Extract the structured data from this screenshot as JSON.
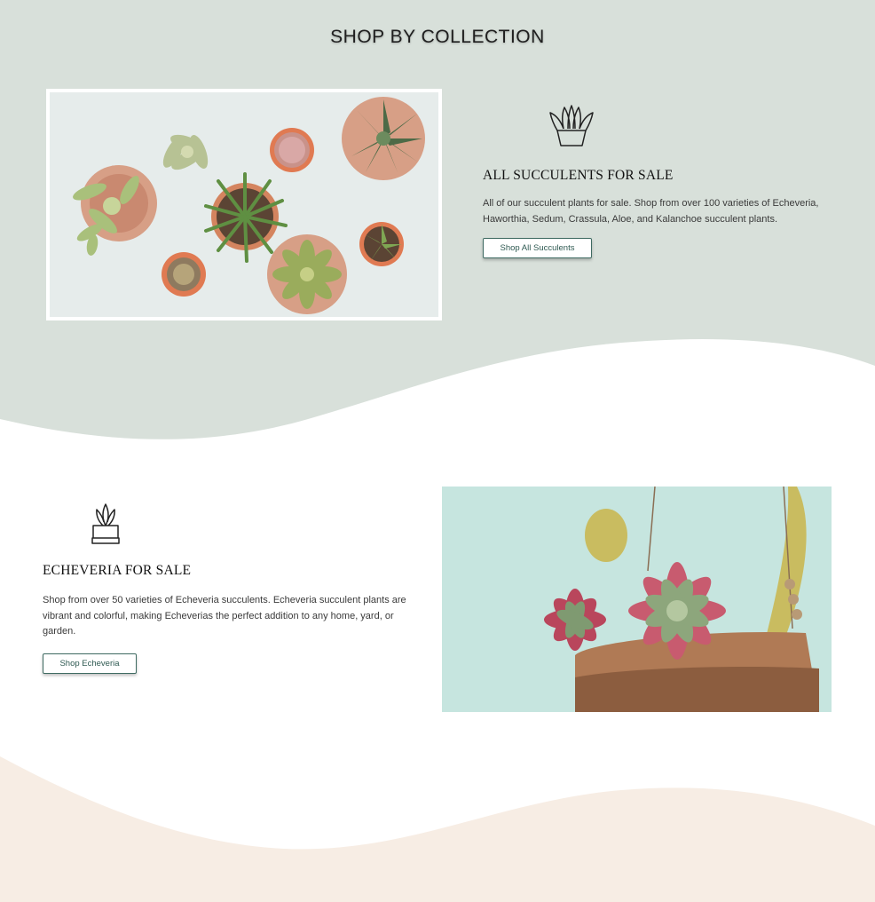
{
  "section_title": "SHOP BY COLLECTION",
  "colors": {
    "sage_background": "#d8e0da",
    "cream_background": "#f7ede4",
    "button_border": "#3f6b62"
  },
  "collections": [
    {
      "icon": "succulent-pot-icon",
      "title": "ALL SUCCULENTS FOR SALE",
      "description": "All of our succulent plants for sale. Shop from over 100 varieties of Echeveria, Haworthia, Sedum, Crassula, Aloe, and Kalanchoe succulent plants.",
      "button_label": "Shop All Succulents",
      "image": "potted-succulents-photo"
    },
    {
      "icon": "echeveria-pot-icon",
      "title": "ECHEVERIA FOR SALE",
      "description": "Shop from over 50 varieties of Echeveria succulents. Echeveria succulent plants are vibrant and colorful, making Echeverias the perfect addition to any home, yard, or garden.",
      "button_label": "Shop Echeveria",
      "image": "hanging-echeveria-photo"
    }
  ]
}
